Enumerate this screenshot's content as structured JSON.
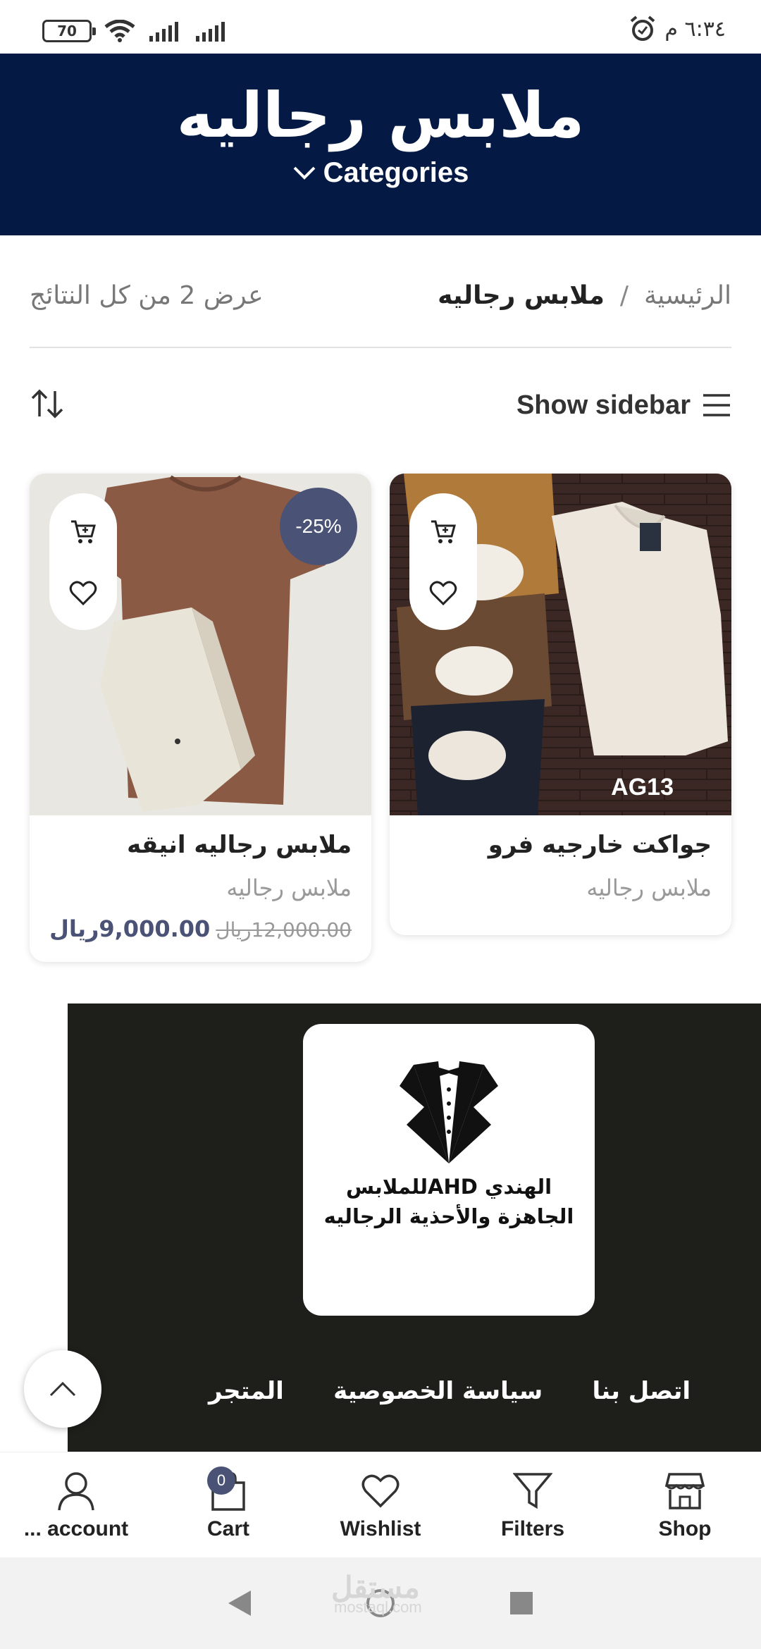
{
  "status_bar": {
    "battery": "70",
    "time": "٦:٣٤ م"
  },
  "header": {
    "title": "ملابس رجاليه",
    "categories_label": "Categories"
  },
  "breadcrumb": {
    "home": "الرئيسية",
    "separator": "/",
    "current": "ملابس رجاليه"
  },
  "results": "عرض 2 من كل النتائج",
  "toolbar": {
    "show_sidebar": "Show sidebar"
  },
  "products": [
    {
      "title": "جواكت خارجيه فرو",
      "category": "ملابس رجاليه",
      "image_label": "AG13"
    },
    {
      "title": "ملابس رجاليه انيقه",
      "category": "ملابس رجاليه",
      "badge": "-25%",
      "old_price": "12,000.00ريال",
      "new_price": "9,000.00ريال"
    }
  ],
  "footer": {
    "logo_text": "الهندي AHDللملابس الجاهزة والأحذية الرجاليه",
    "links": [
      "اتصل بنا",
      "سياسة الخصوصية",
      "المتجر"
    ]
  },
  "bottom_nav": {
    "items": [
      {
        "label": "... account",
        "icon": "user-icon"
      },
      {
        "label": "Cart",
        "icon": "bag-icon",
        "count": "0"
      },
      {
        "label": "Wishlist",
        "icon": "heart-icon"
      },
      {
        "label": "Filters",
        "icon": "filter-icon"
      },
      {
        "label": "Shop",
        "icon": "store-icon"
      }
    ]
  },
  "watermark": {
    "arabic": "مستقل",
    "latin": "mostaql.com"
  },
  "colors": {
    "header_bg": "#041a44",
    "badge": "#4a5275",
    "footer_bg": "#1e1e1a"
  }
}
